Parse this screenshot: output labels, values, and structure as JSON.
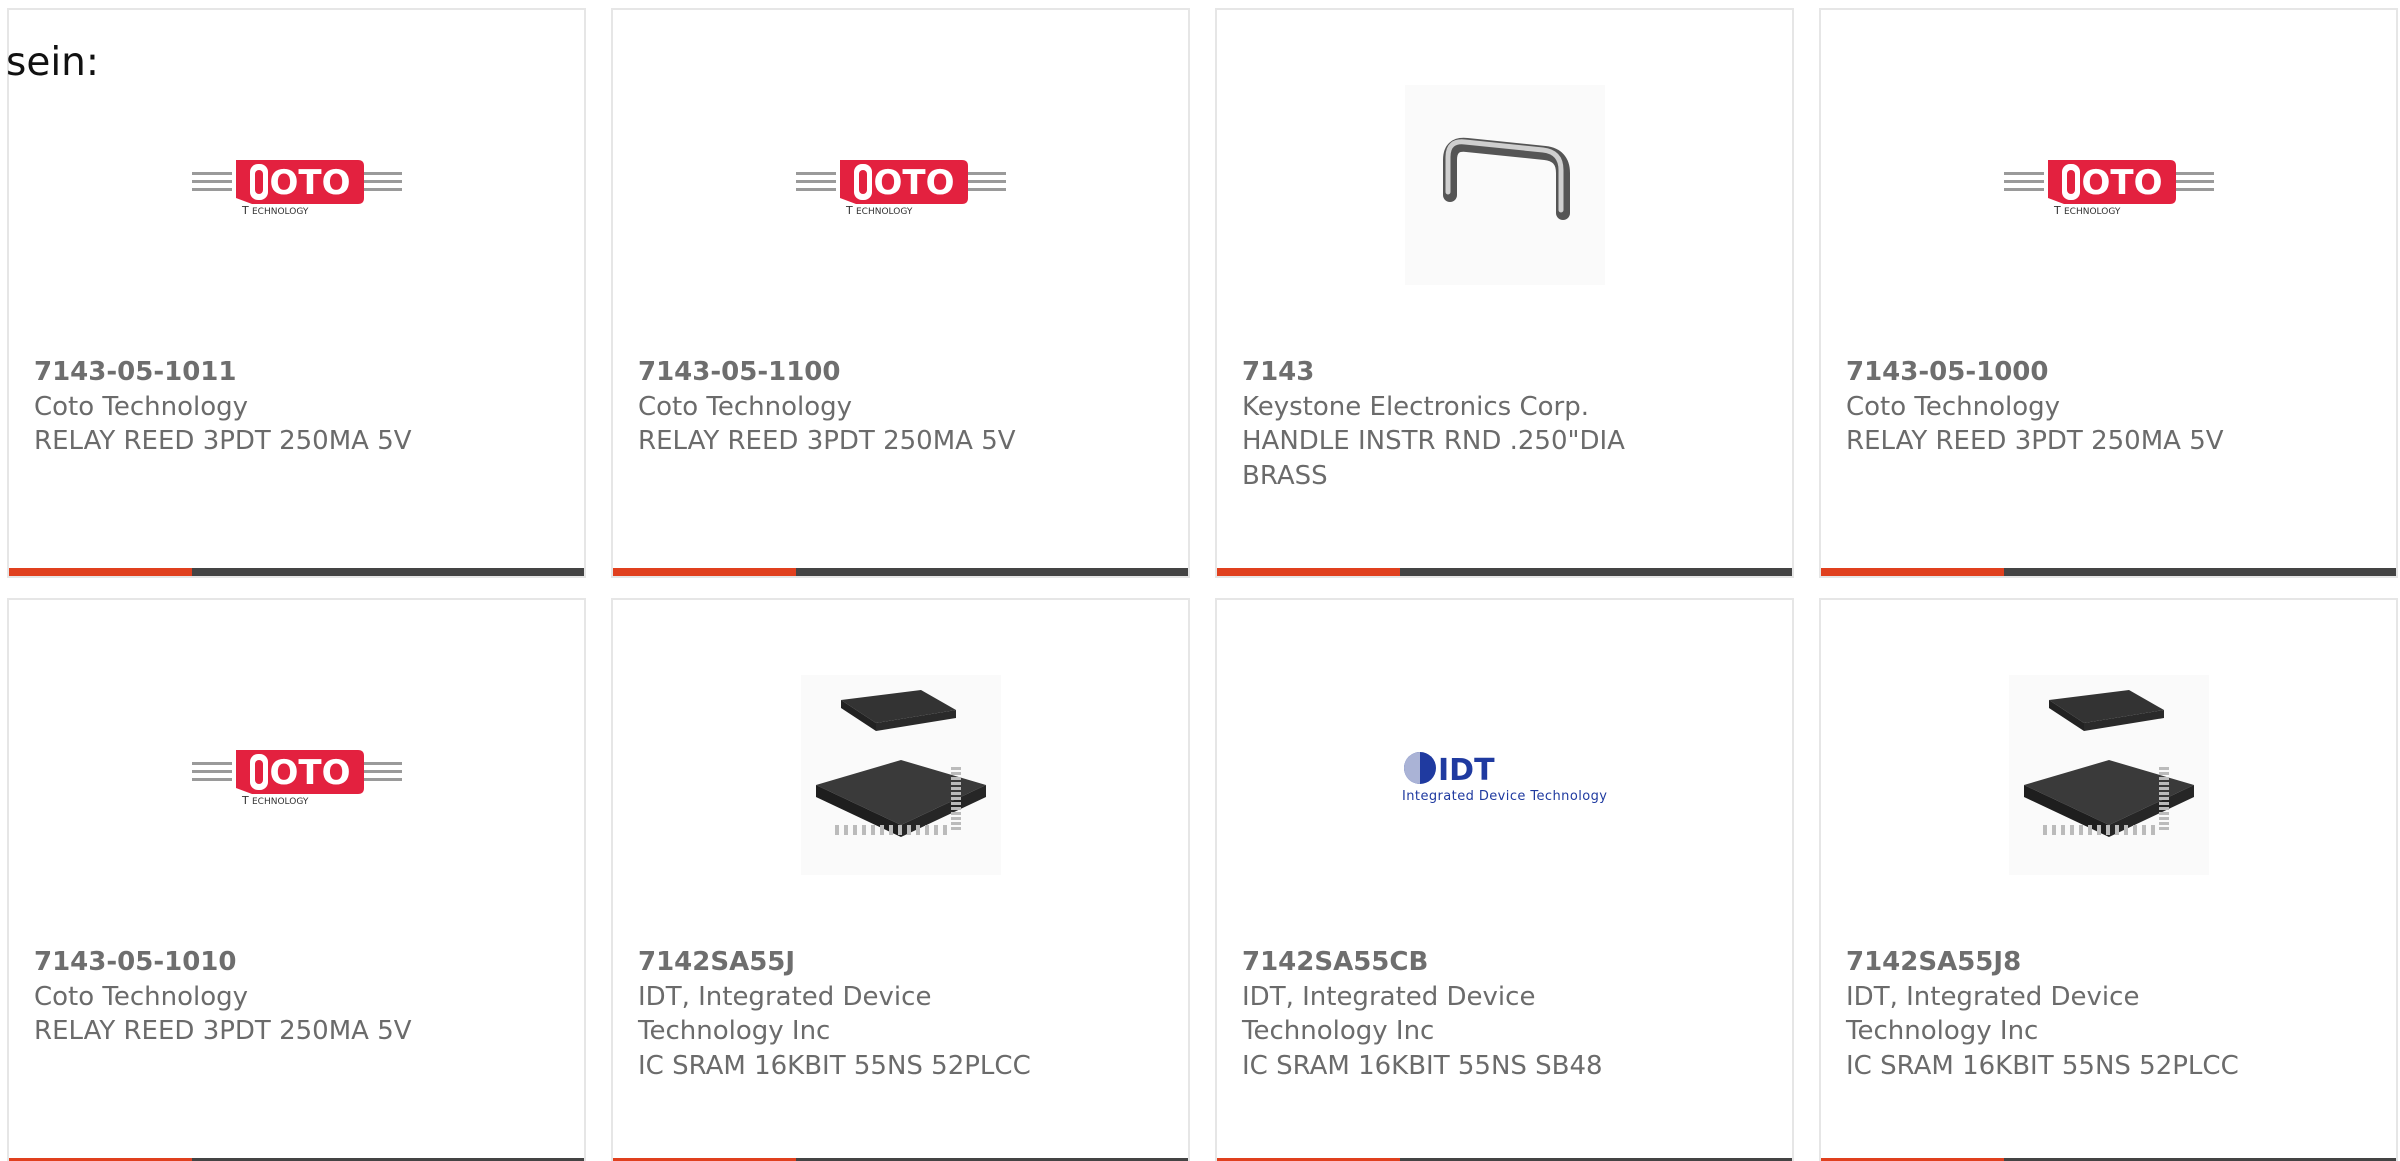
{
  "intro_text": "sein:",
  "colors": {
    "accent": "#e0401e",
    "bar": "#444444",
    "coto_red": "#e3213f",
    "idt_blue": "#1f3aa0"
  },
  "products": [
    {
      "part_number": "7143-05-1011",
      "manufacturer": "Coto Technology",
      "description": "RELAY REED 3PDT 250MA 5V",
      "image": "coto-technology-logo"
    },
    {
      "part_number": "7143-05-1100",
      "manufacturer": "Coto Technology",
      "description": "RELAY REED 3PDT 250MA 5V",
      "image": "coto-technology-logo"
    },
    {
      "part_number": "7143",
      "manufacturer": "Keystone Electronics Corp.",
      "description": "HANDLE INSTR RND .250\"DIA BRASS",
      "image": "instrument-handle-photo"
    },
    {
      "part_number": "7143-05-1000",
      "manufacturer": "Coto Technology",
      "description": "RELAY REED 3PDT 250MA 5V",
      "image": "coto-technology-logo"
    },
    {
      "part_number": "7143-05-1010",
      "manufacturer": "Coto Technology",
      "description": "RELAY REED 3PDT 250MA 5V",
      "image": "coto-technology-logo"
    },
    {
      "part_number": "7142SA55J",
      "manufacturer": "IDT, Integrated Device Technology Inc",
      "description": "IC SRAM 16KBIT 55NS 52PLCC",
      "image": "plcc-chip-photo"
    },
    {
      "part_number": "7142SA55CB",
      "manufacturer": "IDT, Integrated Device Technology Inc",
      "description": "IC SRAM 16KBIT 55NS SB48",
      "image": "idt-logo"
    },
    {
      "part_number": "7142SA55J8",
      "manufacturer": "IDT, Integrated Device Technology Inc",
      "description": "IC SRAM 16KBIT 55NS 52PLCC",
      "image": "plcc-chip-photo"
    }
  ],
  "logos": {
    "coto_wordmark": "OTO",
    "coto_subtitle": "ECHNOLOGY",
    "idt_wordmark": "IDT",
    "idt_subtitle": "Integrated Device Technology"
  }
}
